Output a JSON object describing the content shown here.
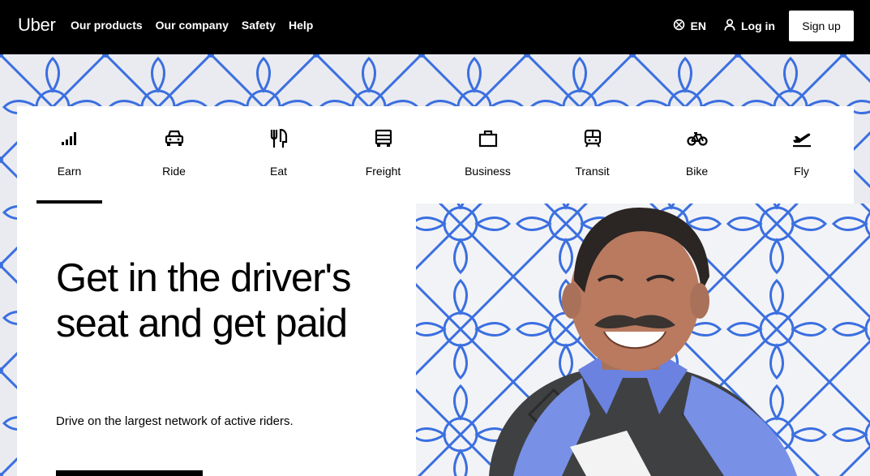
{
  "nav": {
    "logo": "Uber",
    "links": [
      "Our products",
      "Our company",
      "Safety",
      "Help"
    ],
    "language": "EN",
    "login": "Log in",
    "signup": "Sign up"
  },
  "tabs": [
    {
      "label": "Earn",
      "icon": "bars-icon",
      "active": true
    },
    {
      "label": "Ride",
      "icon": "car-icon",
      "active": false
    },
    {
      "label": "Eat",
      "icon": "utensils-icon",
      "active": false
    },
    {
      "label": "Freight",
      "icon": "truck-icon",
      "active": false
    },
    {
      "label": "Business",
      "icon": "briefcase-icon",
      "active": false
    },
    {
      "label": "Transit",
      "icon": "train-icon",
      "active": false
    },
    {
      "label": "Bike",
      "icon": "bike-icon",
      "active": false
    },
    {
      "label": "Fly",
      "icon": "plane-icon",
      "active": false
    }
  ],
  "hero": {
    "title": "Get in the driver's seat and get paid",
    "subtitle": "Drive on the largest network of active riders."
  },
  "colors": {
    "pattern_blue": "#3b6fe0",
    "pattern_bg": "#e9ebf0",
    "nav_bg": "#000000"
  }
}
